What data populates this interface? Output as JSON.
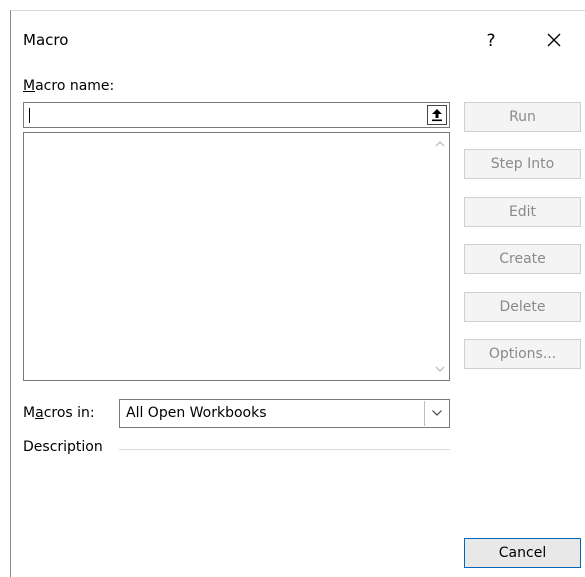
{
  "dialog": {
    "title": "Macro",
    "help_label": "?",
    "close_icon": "close-icon"
  },
  "macro_name": {
    "label_accel": "M",
    "label_rest": "acro name:",
    "value": "",
    "collapse_icon": "upload-arrow-icon"
  },
  "macro_list": {
    "items": [],
    "scroll_up_icon": "chevron-up-icon",
    "scroll_down_icon": "chevron-down-icon"
  },
  "buttons": {
    "run": "Run",
    "step_into": "Step Into",
    "edit": "Edit",
    "create": "Create",
    "delete": "Delete",
    "options": "Options...",
    "cancel": "Cancel"
  },
  "macros_in": {
    "label_pre": "M",
    "label_accel": "a",
    "label_post": "cros in:",
    "selected": "All Open Workbooks",
    "dropdown_icon": "chevron-down-icon"
  },
  "description": {
    "label": "Description",
    "text": ""
  },
  "colors": {
    "accent_border": "#0067c0",
    "disabled_text": "#8a8a8a",
    "button_face": "#f4f4f4"
  }
}
